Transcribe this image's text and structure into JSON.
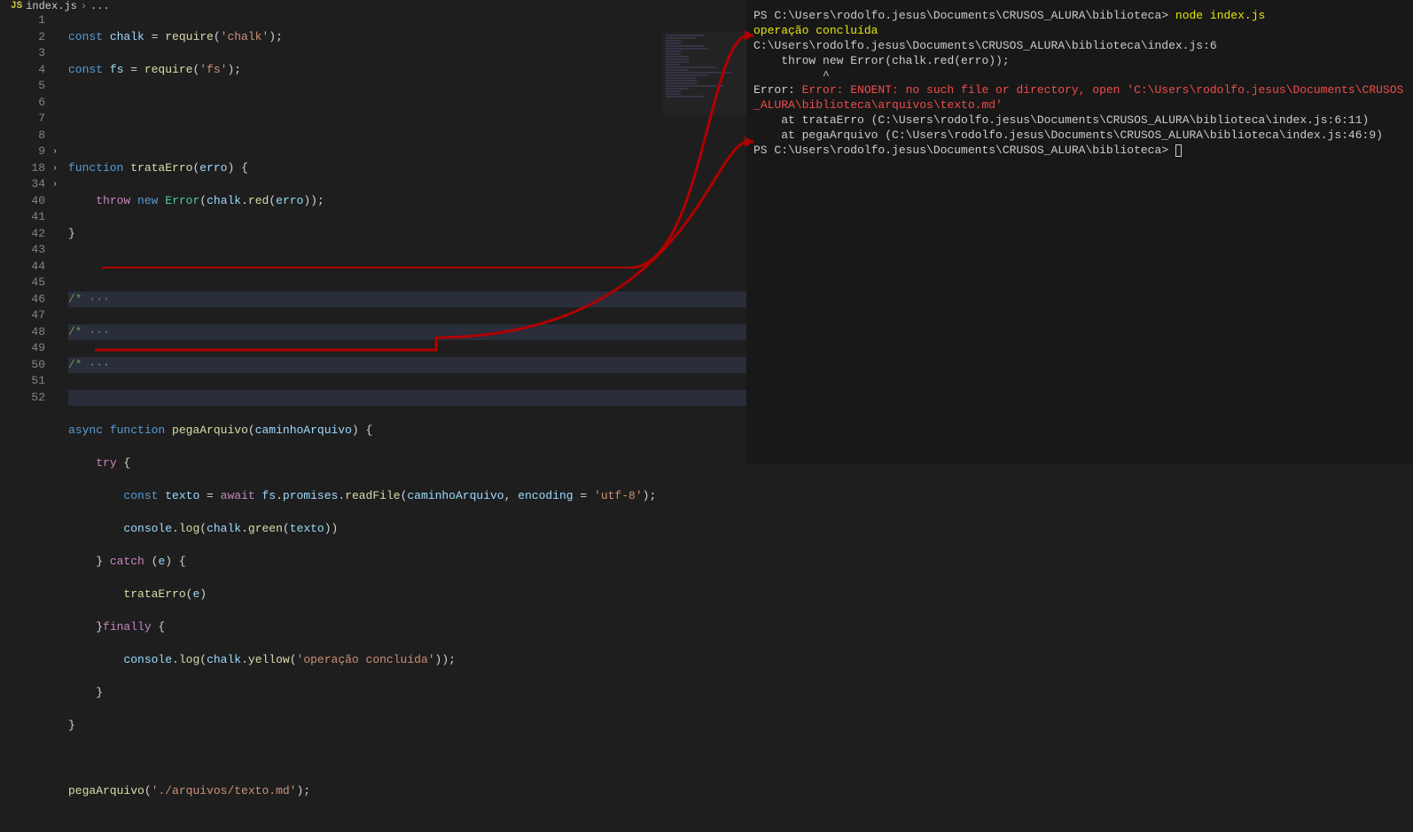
{
  "breadcrumb": {
    "icon_label": "JS",
    "file": "index.js",
    "sep": "›",
    "rest": "..."
  },
  "lines": {
    "l1_a": "const",
    "l1_b": " chalk",
    "l1_c": " = ",
    "l1_d": "require",
    "l1_e": "(",
    "l1_f": "'chalk'",
    "l1_g": ");",
    "l2_a": "const",
    "l2_b": " fs",
    "l2_c": " = ",
    "l2_d": "require",
    "l2_e": "(",
    "l2_f": "'fs'",
    "l2_g": ");",
    "l5_a": "function",
    "l5_b": " trataErro",
    "l5_c": "(",
    "l5_d": "erro",
    "l5_e": ") {",
    "l6_a": "    ",
    "l6_b": "throw",
    "l6_c": " ",
    "l6_d": "new",
    "l6_e": " ",
    "l6_f": "Error",
    "l6_g": "(",
    "l6_h": "chalk",
    "l6_i": ".",
    "l6_j": "red",
    "l6_k": "(",
    "l6_l": "erro",
    "l6_m": "));",
    "l7_a": "}",
    "fold1": "/* ···",
    "fold2": "/* ···",
    "fold3": "/* ···",
    "l41_a": "async",
    "l41_b": " ",
    "l41_c": "function",
    "l41_d": " pegaArquivo",
    "l41_e": "(",
    "l41_f": "caminhoArquivo",
    "l41_g": ") {",
    "l42_a": "    ",
    "l42_b": "try",
    "l42_c": " {",
    "l43_a": "        ",
    "l43_b": "const",
    "l43_c": " texto",
    "l43_d": " = ",
    "l43_e": "await",
    "l43_f": " ",
    "l43_g": "fs",
    "l43_h": ".",
    "l43_i": "promises",
    "l43_j": ".",
    "l43_k": "readFile",
    "l43_l": "(",
    "l43_m": "caminhoArquivo",
    "l43_n": ", ",
    "l43_o": "encoding",
    "l43_p": " = ",
    "l43_q": "'utf-8'",
    "l43_r": ");",
    "l44_a": "        ",
    "l44_b": "console",
    "l44_c": ".",
    "l44_d": "log",
    "l44_e": "(",
    "l44_f": "chalk",
    "l44_g": ".",
    "l44_h": "green",
    "l44_i": "(",
    "l44_j": "texto",
    "l44_k": "))",
    "l45_a": "    } ",
    "l45_b": "catch",
    "l45_c": " (",
    "l45_d": "e",
    "l45_e": ") {",
    "l46_a": "        ",
    "l46_b": "trataErro",
    "l46_c": "(",
    "l46_d": "e",
    "l46_e": ")",
    "l47_a": "    }",
    "l47_b": "finally",
    "l47_c": " {",
    "l48_a": "        ",
    "l48_b": "console",
    "l48_c": ".",
    "l48_d": "log",
    "l48_e": "(",
    "l48_f": "chalk",
    "l48_g": ".",
    "l48_h": "yellow",
    "l48_i": "(",
    "l48_j": "'operação concluída'",
    "l48_k": "));",
    "l49_a": "    }",
    "l50_a": "}",
    "l52_a": "pegaArquivo",
    "l52_b": "(",
    "l52_c": "'./arquivos/texto.md'",
    "l52_d": ");"
  },
  "line_numbers": [
    "1",
    "2",
    "3",
    "4",
    "5",
    "6",
    "7",
    "8",
    "9",
    "18",
    "34",
    "40",
    "41",
    "42",
    "43",
    "44",
    "45",
    "46",
    "47",
    "48",
    "49",
    "50",
    "51",
    "52"
  ],
  "terminal": {
    "l1_a": "PS C:\\Users\\rodolfo.jesus\\Documents\\CRUSOS_ALURA\\biblioteca> ",
    "l1_b": "node index.js",
    "l2": "operação concluída",
    "l3": "C:\\Users\\rodolfo.jesus\\Documents\\CRUSOS_ALURA\\biblioteca\\index.js:6",
    "l4": "    throw new Error(chalk.red(erro));",
    "l5": "          ^",
    "l6": "",
    "l7_a": "Error: ",
    "l7_b": "Error: ENOENT: no such file or directory, open 'C:\\Users\\rodolfo.jesus\\Documents\\CRUSOS_ALURA\\biblioteca\\arquivos\\texto.md'",
    "l8": "    at trataErro (C:\\Users\\rodolfo.jesus\\Documents\\CRUSOS_ALURA\\biblioteca\\index.js:6:11)",
    "l9": "    at pegaArquivo (C:\\Users\\rodolfo.jesus\\Documents\\CRUSOS_ALURA\\biblioteca\\index.js:46:9)",
    "l10": "PS C:\\Users\\rodolfo.jesus\\Documents\\CRUSOS_ALURA\\biblioteca> "
  }
}
